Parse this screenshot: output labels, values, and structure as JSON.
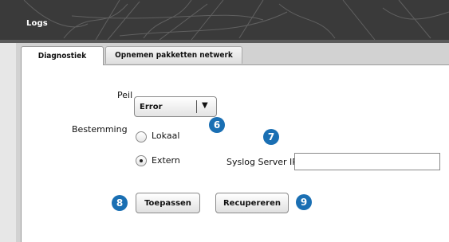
{
  "window": {
    "title": "Logs"
  },
  "tabs": [
    {
      "label": "Diagnostiek",
      "active": true
    },
    {
      "label": "Opnemen pakketten netwerk",
      "active": false
    }
  ],
  "form": {
    "level_label": "Peil",
    "level_value": "Error",
    "destination_label": "Bestemming",
    "destination_options": [
      {
        "label": "Lokaal",
        "selected": false
      },
      {
        "label": "Extern",
        "selected": true
      }
    ],
    "syslog_label": "Syslog Server IP",
    "syslog_value": ""
  },
  "buttons": {
    "apply": "Toepassen",
    "retrieve": "Recupereren"
  },
  "callouts": {
    "level": "6",
    "syslog": "7",
    "apply": "8",
    "retrieve": "9"
  },
  "colors": {
    "header_bg": "#3a3a3a",
    "callout": "#1a6fb3",
    "panel_bg": "#ffffff"
  }
}
